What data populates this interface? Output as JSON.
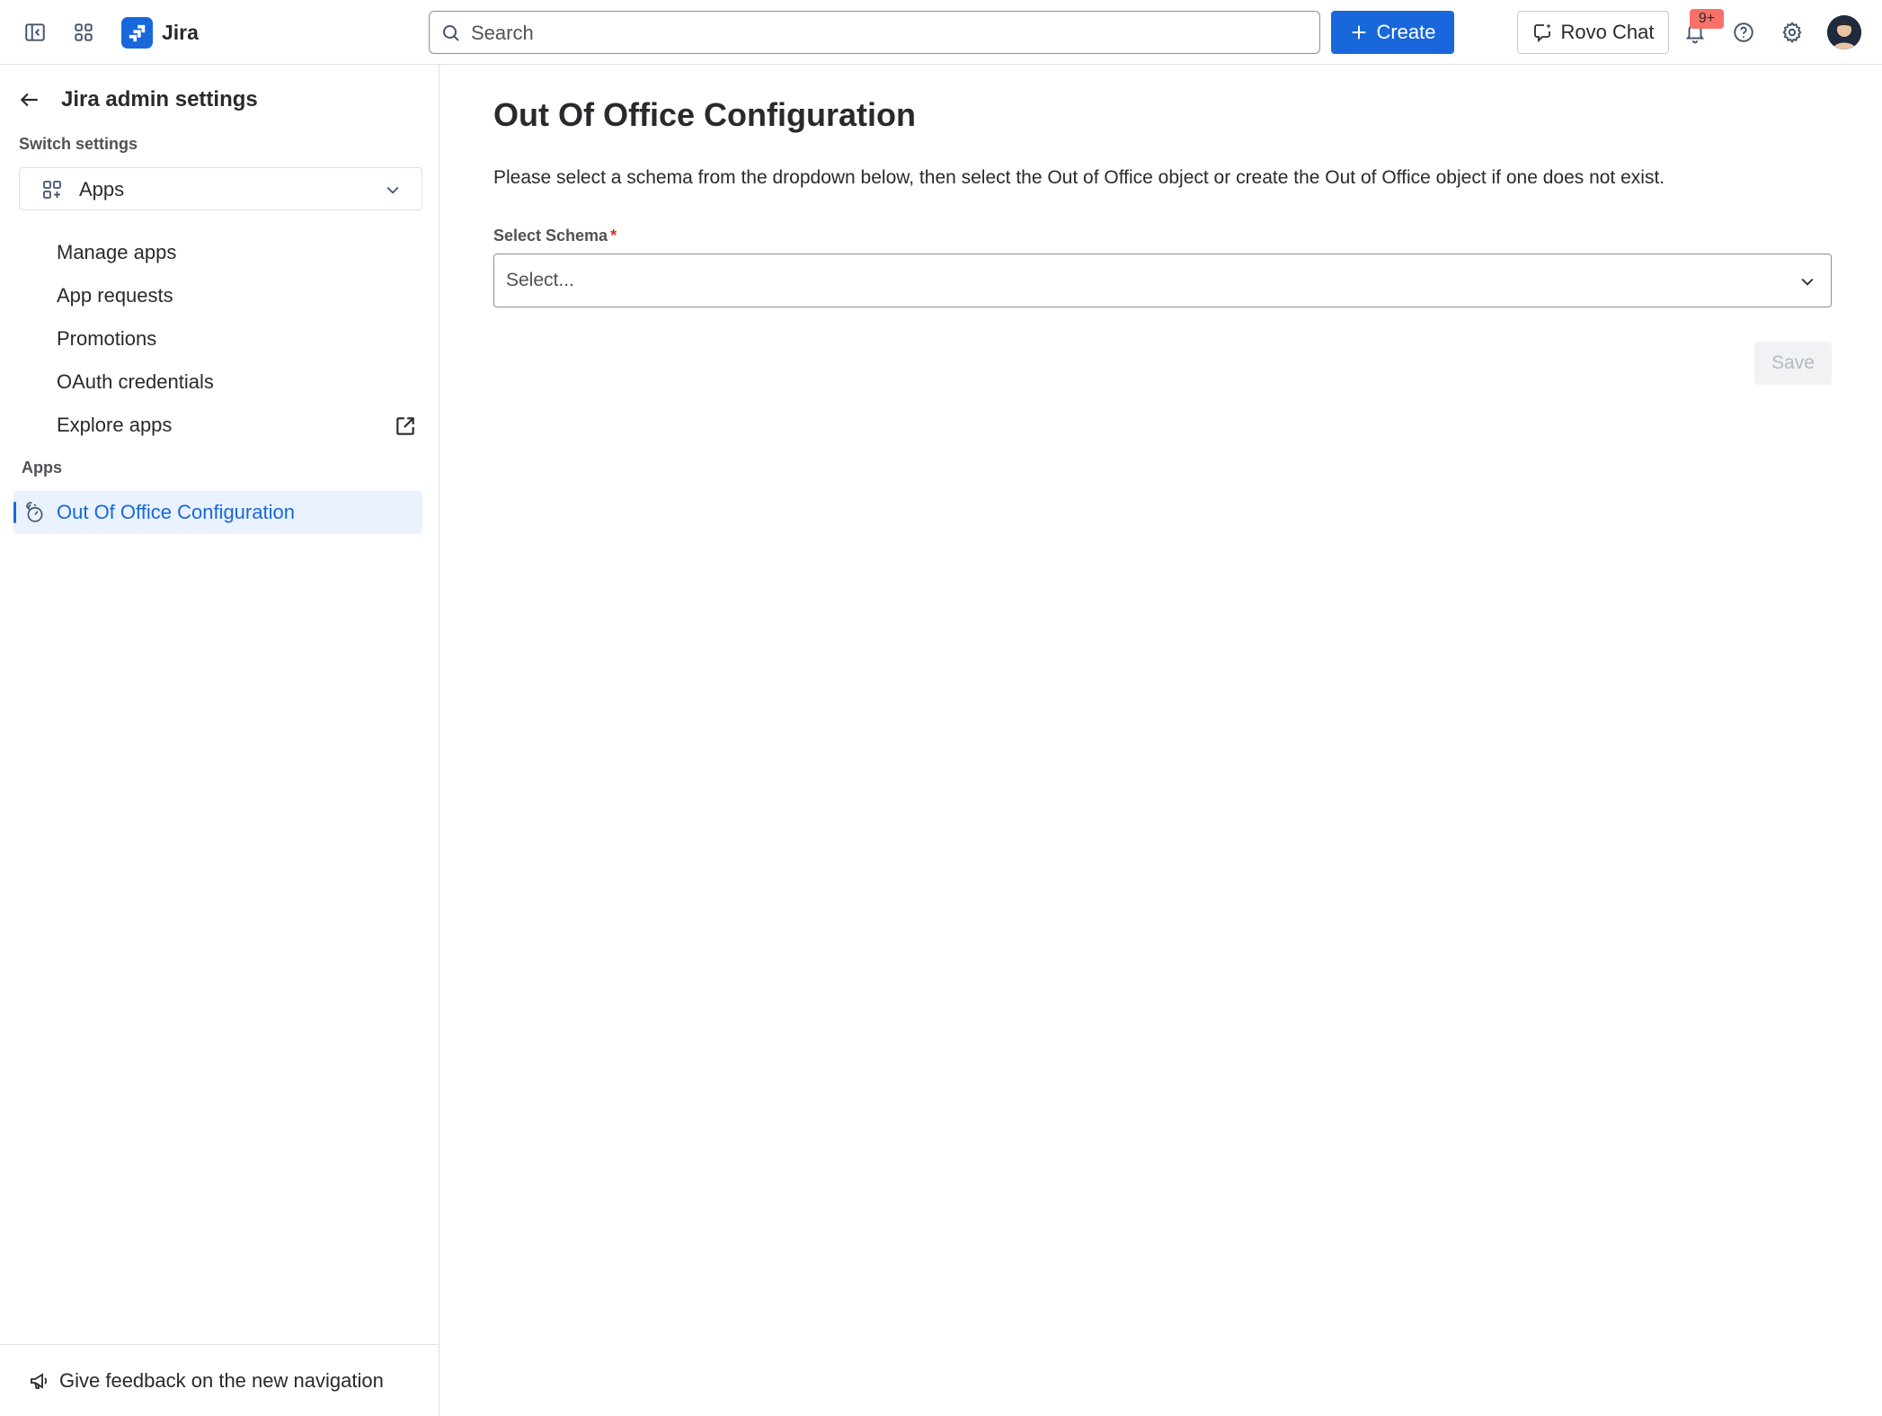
{
  "topbar": {
    "app_name": "Jira",
    "search_placeholder": "Search",
    "create_label": "Create",
    "rovo_label": "Rovo Chat",
    "notification_badge": "9+"
  },
  "sidebar": {
    "back_title": "Jira admin settings",
    "switch_settings_label": "Switch settings",
    "switcher_value": "Apps",
    "nav_items": [
      {
        "label": "Manage apps"
      },
      {
        "label": "App requests"
      },
      {
        "label": "Promotions"
      },
      {
        "label": "OAuth credentials"
      },
      {
        "label": "Explore apps"
      }
    ],
    "apps_section_label": "Apps",
    "selected_app": "Out Of Office Configuration",
    "feedback_label": "Give feedback on the new navigation"
  },
  "main": {
    "title": "Out Of Office Configuration",
    "description": "Please select a schema from the dropdown below, then select the Out of Office object or create the Out of Office object if one does not exist.",
    "field_label": "Select Schema",
    "required_mark": "*",
    "select_placeholder": "Select...",
    "save_label": "Save"
  },
  "colors": {
    "brand_blue": "#1868db",
    "selected_bg": "#e9f2fe",
    "badge_red": "#f87168",
    "required_red": "#c9372c"
  },
  "icons": [
    "sidebar-toggle-icon",
    "app-switcher-icon",
    "jira-logo-icon",
    "search-icon",
    "plus-icon",
    "rovo-chat-icon",
    "bell-icon",
    "help-icon",
    "gear-icon",
    "back-arrow-icon",
    "apps-grid-icon",
    "chevron-down-icon",
    "external-link-icon",
    "stopwatch-icon",
    "megaphone-icon"
  ]
}
